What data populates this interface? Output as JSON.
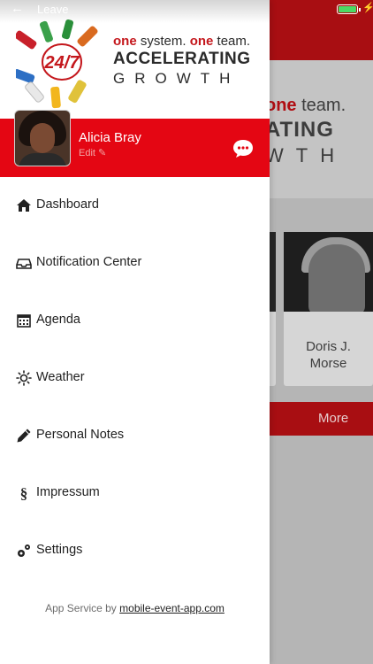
{
  "status_bar": {
    "back_label": "Leave"
  },
  "background_app": {
    "logo": {
      "line1_red": "one",
      "line1_rest": "team.",
      "line2": "ATING",
      "line3": "WTH"
    },
    "speaker": {
      "name_line1": "Doris J.",
      "name_line2": "Morse"
    },
    "more_label": "More"
  },
  "drawer": {
    "logo": {
      "badge": "24/7",
      "line1_red_a": "one",
      "line1_a": "system.",
      "line1_red_b": "one",
      "line1_b": "team.",
      "line2": "ACCELERATING",
      "line3": "GROWTH"
    },
    "profile": {
      "name": "Alicia Bray",
      "edit_label": "Edit"
    },
    "menu": [
      {
        "label": "Dashboard",
        "icon": "home-icon"
      },
      {
        "label": "Notification Center",
        "icon": "inbox-icon"
      },
      {
        "label": "Agenda",
        "icon": "calendar-icon"
      },
      {
        "label": "Weather",
        "icon": "sun-icon"
      },
      {
        "label": "Personal Notes",
        "icon": "pencil-icon"
      },
      {
        "label": "Impressum",
        "icon": "section-icon"
      },
      {
        "label": "Settings",
        "icon": "gears-icon"
      }
    ],
    "footer": {
      "prefix": "App Service by",
      "link": "mobile-event-app.com"
    }
  },
  "colors": {
    "brand_red": "#e40613",
    "dark_red": "#a80e12",
    "battery_green": "#4cd964"
  }
}
